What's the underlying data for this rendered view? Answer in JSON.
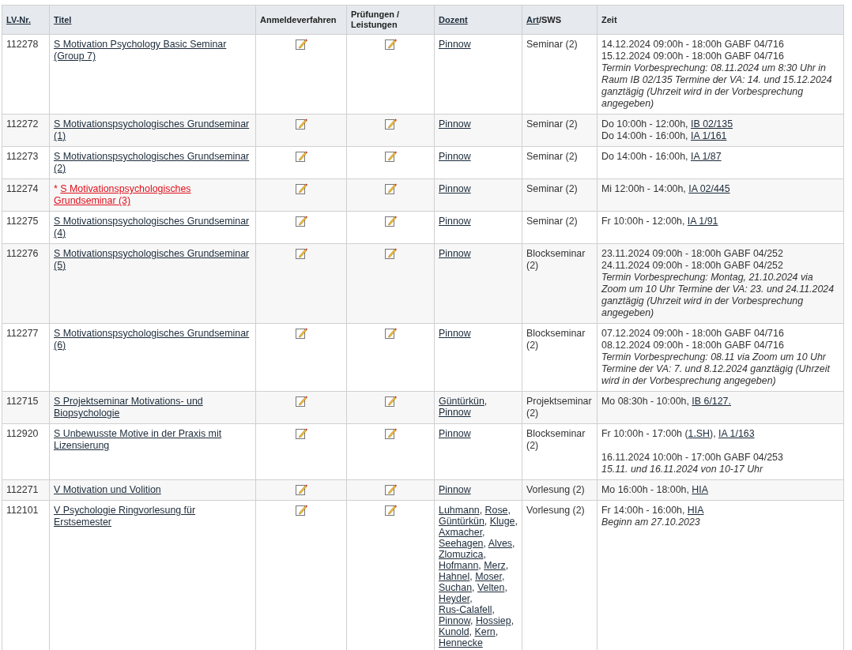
{
  "columns": [
    {
      "parts": [
        {
          "text": "LV-Nr.",
          "kind": "link"
        }
      ]
    },
    {
      "parts": [
        {
          "text": "Titel",
          "kind": "link"
        }
      ]
    },
    {
      "parts": [
        {
          "text": "Anmeldeverfahren",
          "kind": "text"
        }
      ]
    },
    {
      "parts": [
        {
          "text": "Prüfungen / Leistungen",
          "kind": "text"
        }
      ]
    },
    {
      "parts": [
        {
          "text": "Dozent",
          "kind": "link"
        }
      ]
    },
    {
      "parts": [
        {
          "text": "Art",
          "kind": "link"
        },
        {
          "text": "/SWS",
          "kind": "text"
        }
      ]
    },
    {
      "parts": [
        {
          "text": "Zeit",
          "kind": "text"
        }
      ]
    }
  ],
  "rows": [
    {
      "number": "112278",
      "highlighted": false,
      "title": "S Motivation Psychology Basic Seminar (Group 7)",
      "lecturers": [
        {
          "name": "Pinnow"
        }
      ],
      "type": "Seminar (2)",
      "time": [
        {
          "kind": "slot",
          "parts": [
            {
              "text": "14.12.2024 09:00h - 18:00h GABF 04/716",
              "kind": "text"
            }
          ]
        },
        {
          "kind": "slot",
          "parts": [
            {
              "text": "15.12.2024 09:00h - 18:00h GABF 04/716",
              "kind": "text"
            }
          ]
        },
        {
          "kind": "note",
          "parts": [
            {
              "text": "Termin Vorbesprechung: 08.11.2024 um 8:30 Uhr in Raum IB 02/135 Termine der VA: 14. und 15.12.2024 ganztägig (Uhrzeit wird in der Vorbesprechung angegeben)",
              "kind": "text"
            }
          ]
        }
      ]
    },
    {
      "number": "112272",
      "highlighted": false,
      "title": "S Motivationspsychologisches Grundseminar (1)",
      "lecturers": [
        {
          "name": "Pinnow"
        }
      ],
      "type": "Seminar (2)",
      "time": [
        {
          "kind": "slot",
          "parts": [
            {
              "text": "Do 10:00h - 12:00h, ",
              "kind": "text"
            },
            {
              "text": "IB 02/135",
              "kind": "link"
            }
          ]
        },
        {
          "kind": "slot",
          "parts": [
            {
              "text": "Do 14:00h - 16:00h, ",
              "kind": "text"
            },
            {
              "text": "IA 1/161",
              "kind": "link"
            }
          ]
        }
      ]
    },
    {
      "number": "112273",
      "highlighted": false,
      "title": "S Motivationspsychologisches Grundseminar (2)",
      "lecturers": [
        {
          "name": "Pinnow"
        }
      ],
      "type": "Seminar (2)",
      "time": [
        {
          "kind": "slot",
          "parts": [
            {
              "text": "Do 14:00h - 16:00h, ",
              "kind": "text"
            },
            {
              "text": "IA 1/87",
              "kind": "link"
            }
          ]
        }
      ]
    },
    {
      "number": "112274",
      "highlighted": true,
      "flag": "*",
      "title": "S Motivationspsychologisches Grundseminar (3)",
      "lecturers": [
        {
          "name": "Pinnow"
        }
      ],
      "type": "Seminar (2)",
      "time": [
        {
          "kind": "slot",
          "parts": [
            {
              "text": "Mi 12:00h - 14:00h, ",
              "kind": "text"
            },
            {
              "text": "IA 02/445",
              "kind": "link"
            }
          ]
        }
      ]
    },
    {
      "number": "112275",
      "highlighted": false,
      "title": "S Motivationspsychologisches Grundseminar (4)",
      "lecturers": [
        {
          "name": "Pinnow"
        }
      ],
      "type": "Seminar (2)",
      "time": [
        {
          "kind": "slot",
          "parts": [
            {
              "text": "Fr 10:00h - 12:00h, ",
              "kind": "text"
            },
            {
              "text": "IA 1/91",
              "kind": "link"
            }
          ]
        }
      ]
    },
    {
      "number": "112276",
      "highlighted": false,
      "title": "S Motivationspsychologisches Grundseminar (5)",
      "lecturers": [
        {
          "name": "Pinnow"
        }
      ],
      "type": "Blockseminar (2)",
      "time": [
        {
          "kind": "slot",
          "parts": [
            {
              "text": "23.11.2024 09:00h - 18:00h GABF 04/252",
              "kind": "text"
            }
          ]
        },
        {
          "kind": "slot",
          "parts": [
            {
              "text": "24.11.2024 09:00h - 18:00h GABF 04/252",
              "kind": "text"
            }
          ]
        },
        {
          "kind": "note",
          "parts": [
            {
              "text": "Termin Vorbesprechung: Montag, 21.10.2024 via Zoom um 10 Uhr Termine der VA: 23. und 24.11.2024 ganztägig (Uhrzeit wird in der Vorbesprechung angegeben)",
              "kind": "text"
            }
          ]
        }
      ]
    },
    {
      "number": "112277",
      "highlighted": false,
      "title": "S Motivationspsychologisches Grundseminar (6)",
      "lecturers": [
        {
          "name": "Pinnow"
        }
      ],
      "type": "Blockseminar (2)",
      "time": [
        {
          "kind": "slot",
          "parts": [
            {
              "text": "07.12.2024 09:00h - 18:00h GABF 04/716",
              "kind": "text"
            }
          ]
        },
        {
          "kind": "slot",
          "parts": [
            {
              "text": "08.12.2024 09:00h - 18:00h GABF 04/716",
              "kind": "text"
            }
          ]
        },
        {
          "kind": "note",
          "parts": [
            {
              "text": "Termin Vorbesprechung: 08.11 via Zoom um 10 Uhr Termine der VA: 7. und 8.12.2024 ganztägig (Uhrzeit wird in der Vorbesprechung angegeben)",
              "kind": "text"
            }
          ]
        }
      ]
    },
    {
      "number": "112715",
      "highlighted": false,
      "title": "S Projektseminar Motivations- und Biopsychologie",
      "lecturers": [
        {
          "name": "Güntürkün",
          "sep": ","
        },
        {
          "name": "Pinnow"
        }
      ],
      "type": "Projektseminar (2)",
      "time": [
        {
          "kind": "slot",
          "parts": [
            {
              "text": "Mo 08:30h - 10:00h, ",
              "kind": "text"
            },
            {
              "text": "IB 6/127.",
              "kind": "link"
            }
          ]
        }
      ]
    },
    {
      "number": "112920",
      "highlighted": false,
      "title": "S Unbewusste Motive in der Praxis mit Lizensierung",
      "lecturers": [
        {
          "name": "Pinnow"
        }
      ],
      "type": "Blockseminar (2)",
      "time": [
        {
          "kind": "slot",
          "parts": [
            {
              "text": "Fr 10:00h - 17:00h (",
              "kind": "text"
            },
            {
              "text": "1.SH",
              "kind": "link"
            },
            {
              "text": "), ",
              "kind": "text"
            },
            {
              "text": "IA 1/163",
              "kind": "link"
            }
          ]
        },
        {
          "kind": "blank"
        },
        {
          "kind": "slot",
          "parts": [
            {
              "text": "16.11.2024 10:00h - 17:00h GABF 04/253",
              "kind": "text"
            }
          ]
        },
        {
          "kind": "note",
          "parts": [
            {
              "text": "15.11. und 16.11.2024 von 10-17 Uhr",
              "kind": "text"
            }
          ]
        }
      ]
    },
    {
      "number": "112271",
      "highlighted": false,
      "title": "V Motivation und Volition",
      "lecturers": [
        {
          "name": "Pinnow"
        }
      ],
      "type": "Vorlesung (2)",
      "time": [
        {
          "kind": "slot",
          "parts": [
            {
              "text": "Mo 16:00h - 18:00h, ",
              "kind": "text"
            },
            {
              "text": "HIA",
              "kind": "link"
            }
          ]
        }
      ]
    },
    {
      "number": "112101",
      "highlighted": false,
      "title": "V Psychologie Ringvorlesung für Erstsemester",
      "lecturers": [
        {
          "name": "Luhmann",
          "sep": ","
        },
        {
          "name": "Rose",
          "sep": ","
        },
        {
          "name": "Güntürkün",
          "sep": ","
        },
        {
          "name": "Kluge",
          "sep": ","
        },
        {
          "name": "Axmacher",
          "sep": ","
        },
        {
          "name": "Seehagen",
          "sep": ","
        },
        {
          "name": "Alves",
          "sep": ","
        },
        {
          "name": "Zlomuzica",
          "sep": ","
        },
        {
          "name": "Hofmann",
          "sep": ","
        },
        {
          "name": "Merz",
          "sep": ","
        },
        {
          "name": "Hahnel",
          "sep": ","
        },
        {
          "name": "Moser",
          "sep": ","
        },
        {
          "name": "Suchan",
          "sep": ","
        },
        {
          "name": "Velten",
          "sep": ","
        },
        {
          "name": "Heyder",
          "sep": ","
        },
        {
          "name": "Rus-Calafell",
          "sep": ","
        },
        {
          "name": "Pinnow",
          "sep": ","
        },
        {
          "name": "Hossiep",
          "sep": ","
        },
        {
          "name": "Kunold",
          "sep": ","
        },
        {
          "name": "Kern",
          "sep": ","
        },
        {
          "name": "Hennecke"
        }
      ],
      "type": "Vorlesung (2)",
      "time": [
        {
          "kind": "slot",
          "parts": [
            {
              "text": "Fr 14:00h - 16:00h, ",
              "kind": "text"
            },
            {
              "text": "HIA",
              "kind": "link"
            }
          ]
        },
        {
          "kind": "note",
          "parts": [
            {
              "text": "Beginn am 27.10.2023",
              "kind": "text"
            }
          ]
        }
      ]
    }
  ]
}
